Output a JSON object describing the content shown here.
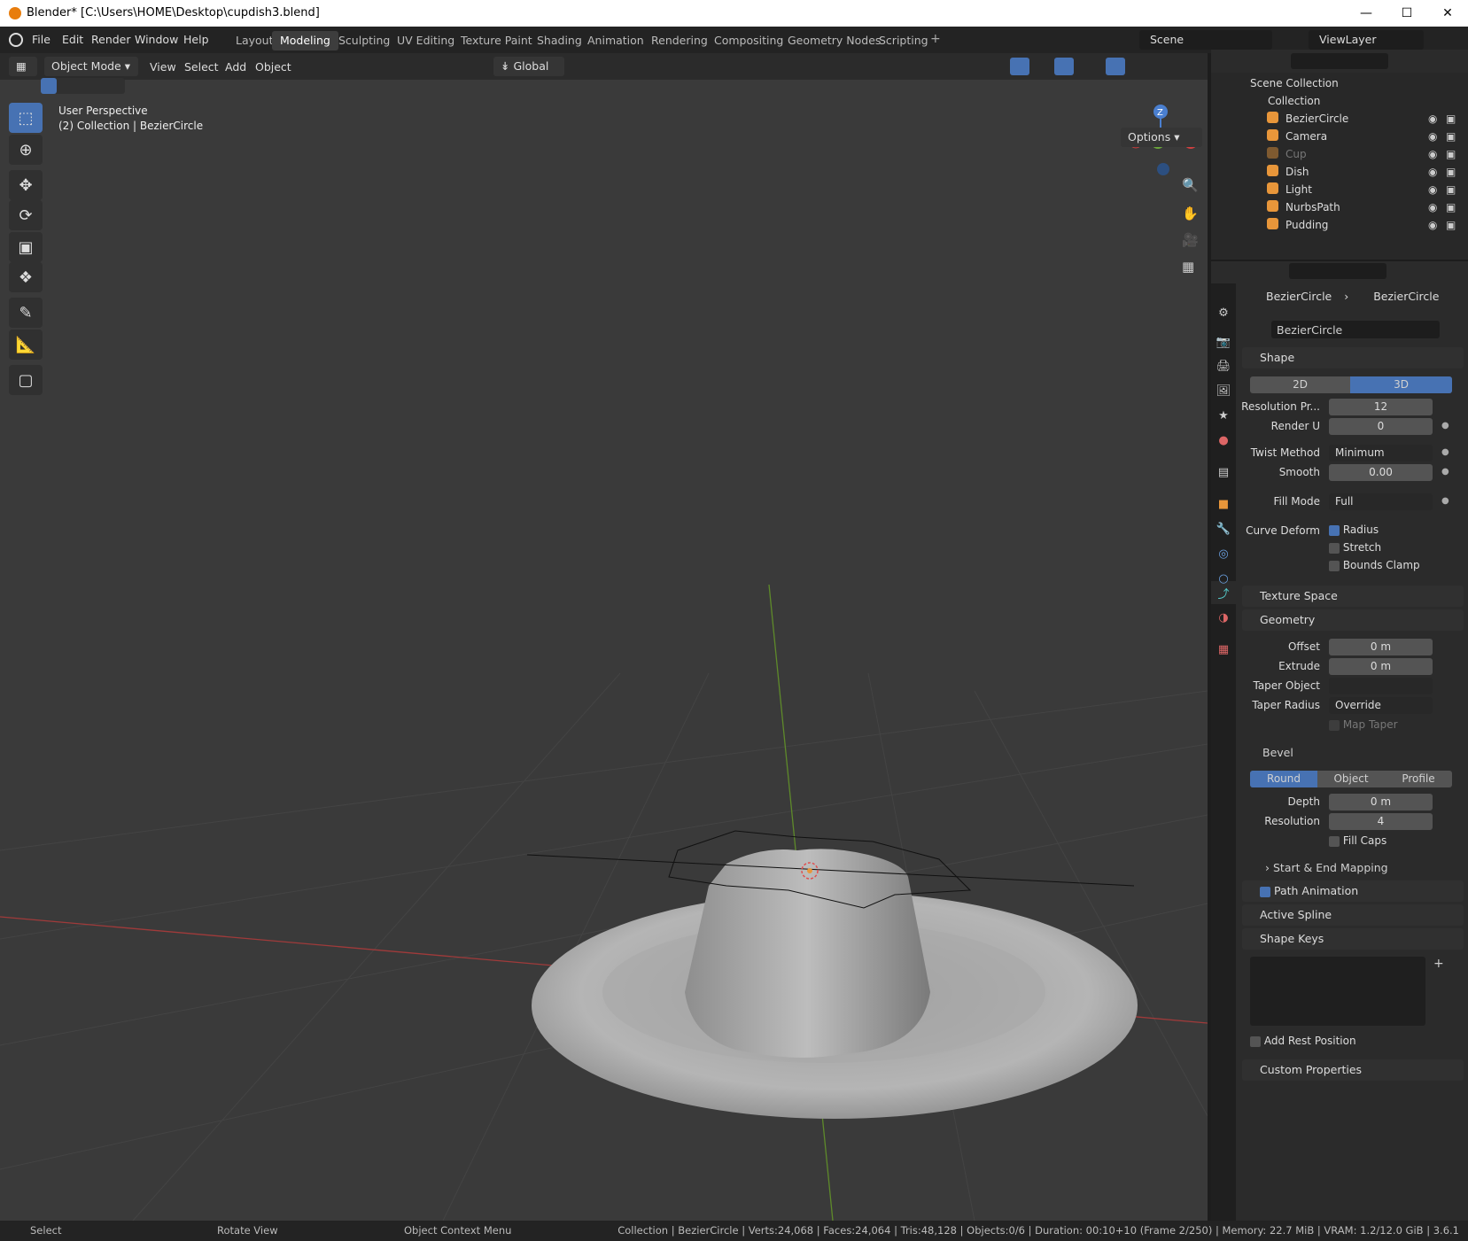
{
  "title": "Blender* [C:\\Users\\HOME\\Desktop\\cupdish3.blend]",
  "menu": [
    "File",
    "Edit",
    "Render",
    "Window",
    "Help"
  ],
  "workspaces": [
    {
      "label": "Layout"
    },
    {
      "label": "Modeling",
      "active": true
    },
    {
      "label": "Sculpting"
    },
    {
      "label": "UV Editing"
    },
    {
      "label": "Texture Paint"
    },
    {
      "label": "Shading"
    },
    {
      "label": "Animation"
    },
    {
      "label": "Rendering"
    },
    {
      "label": "Compositing"
    },
    {
      "label": "Geometry Nodes"
    },
    {
      "label": "Scripting"
    }
  ],
  "scene": "Scene",
  "view_layer": "ViewLayer",
  "viewport": {
    "mode": "Object Mode",
    "menus": [
      "View",
      "Select",
      "Add",
      "Object"
    ],
    "orientation": "Global",
    "options": "Options",
    "perspective": "User Perspective",
    "context": "(2) Collection | BezierCircle",
    "gizmo": {
      "z": "Z",
      "y": "Y",
      "x": "X"
    }
  },
  "outliner": {
    "root": "Scene Collection",
    "collection": "Collection",
    "items": [
      {
        "name": "BezierCircle",
        "icon_color": "#e8963a",
        "dim": false
      },
      {
        "name": "Camera",
        "icon_color": "#e8963a",
        "dim": false
      },
      {
        "name": "Cup",
        "icon_color": "#e8963a",
        "dim": true
      },
      {
        "name": "Dish",
        "icon_color": "#e8963a",
        "dim": false
      },
      {
        "name": "Light",
        "icon_color": "#e8963a",
        "dim": false
      },
      {
        "name": "NurbsPath",
        "icon_color": "#e8963a",
        "dim": false
      },
      {
        "name": "Pudding",
        "icon_color": "#e8963a",
        "dim": false
      }
    ]
  },
  "properties": {
    "breadcrumb_object": "BezierCircle",
    "breadcrumb_data": "BezierCircle",
    "datablock": "BezierCircle",
    "shape": {
      "header": "Shape",
      "dim_2d": "2D",
      "dim_3d": "3D",
      "res_preview_label": "Resolution Pr...",
      "res_preview": "12",
      "render_u_label": "Render U",
      "render_u": "0",
      "twist_label": "Twist Method",
      "twist": "Minimum",
      "smooth_label": "Smooth",
      "smooth": "0.00",
      "fill_label": "Fill Mode",
      "fill": "Full",
      "curve_deform_label": "Curve Deform",
      "radius": "Radius",
      "stretch": "Stretch",
      "bounds": "Bounds Clamp"
    },
    "texture_space": "Texture Space",
    "geometry": {
      "header": "Geometry",
      "offset_label": "Offset",
      "offset": "0 m",
      "extrude_label": "Extrude",
      "extrude": "0 m",
      "taper_obj_label": "Taper Object",
      "taper_rad_label": "Taper Radius",
      "taper_rad": "Override",
      "map_taper": "Map Taper"
    },
    "bevel": {
      "header": "Bevel",
      "round": "Round",
      "object": "Object",
      "profile": "Profile",
      "depth_label": "Depth",
      "depth": "0 m",
      "resolution_label": "Resolution",
      "resolution": "4",
      "fill_caps": "Fill Caps"
    },
    "start_end": "Start & End Mapping",
    "path_anim": "Path Animation",
    "active_spline": "Active Spline",
    "shape_keys": "Shape Keys",
    "add_rest": "Add Rest Position",
    "custom_props": "Custom Properties"
  },
  "status": {
    "select": "Select",
    "rotate": "Rotate View",
    "context_menu": "Object Context Menu",
    "info": "Collection | BezierCircle | Verts:24,068 | Faces:24,064 | Tris:48,128 | Objects:0/6 | Duration: 00:10+10 (Frame 2/250) | Memory: 22.7 MiB | VRAM: 1.2/12.0 GiB | 3.6.1"
  }
}
